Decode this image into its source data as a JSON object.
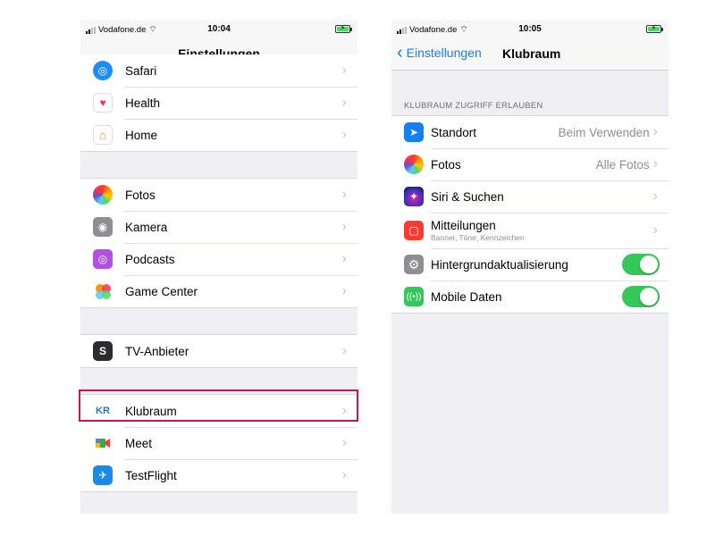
{
  "left": {
    "status": {
      "carrier": "Vodafone.de",
      "time": "10:04"
    },
    "nav_title": "Einstellungen",
    "partial_item": "Safari",
    "group1": [
      {
        "label": "Health"
      },
      {
        "label": "Home"
      }
    ],
    "group2": [
      {
        "label": "Fotos"
      },
      {
        "label": "Kamera"
      },
      {
        "label": "Podcasts"
      },
      {
        "label": "Game Center"
      }
    ],
    "group3": [
      {
        "label": "TV-Anbieter"
      }
    ],
    "group4": [
      {
        "label": "Klubraum",
        "icon_text": "KR"
      },
      {
        "label": "Meet"
      },
      {
        "label": "TestFlight"
      }
    ]
  },
  "right": {
    "status": {
      "carrier": "Vodafone.de",
      "time": "10:05"
    },
    "back_label": "Einstellungen",
    "nav_title": "Klubraum",
    "section_header": "KLUBRAUM ZUGRIFF ERLAUBEN",
    "items": [
      {
        "label": "Standort",
        "value": "Beim Verwenden"
      },
      {
        "label": "Fotos",
        "value": "Alle Fotos"
      },
      {
        "label": "Siri & Suchen"
      },
      {
        "label": "Mitteilungen",
        "sub": "Banner, Töne, Kennzeichen"
      },
      {
        "label": "Hintergrundaktualisierung",
        "toggle": true
      },
      {
        "label": "Mobile Daten",
        "toggle": true
      }
    ]
  },
  "colors": {
    "accent": "#147efb",
    "highlight": "#c2185b",
    "toggle_on": "#34c759"
  }
}
